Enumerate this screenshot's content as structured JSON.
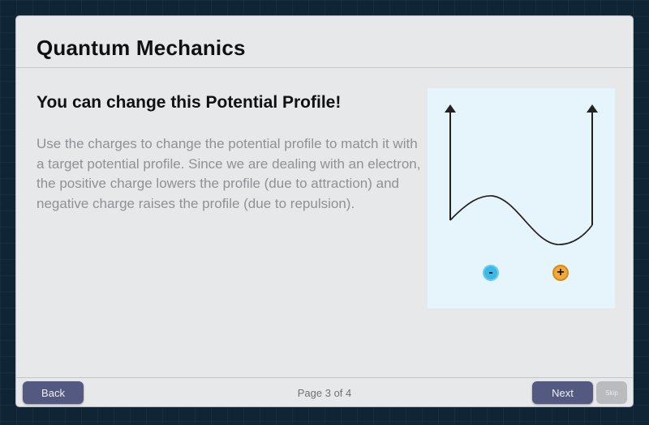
{
  "header": {
    "title": "Quantum Mechanics"
  },
  "content": {
    "title": "You can change this Potential Profile!",
    "body": "Use the charges to change the potential profile to match it with a target potential profile. Since we are dealing with an electron, the positive charge lowers the profile (due to attraction) and negative charge raises the profile (due to repulsion)."
  },
  "illustration": {
    "negative_charge_symbol": "-",
    "positive_charge_symbol": "+",
    "negative_charge_color": "#3db7e4",
    "positive_charge_color": "#f0a93a",
    "panel_color": "#e6f4fb"
  },
  "footer": {
    "back_label": "Back",
    "page_indicator": "Page 3 of 4",
    "next_label": "Next",
    "skip_label": "Skip"
  },
  "colors": {
    "button": "#535980",
    "button_disabled": "#b9bbbe",
    "background": "#0f2536",
    "dialog": "#e7e8e9"
  }
}
